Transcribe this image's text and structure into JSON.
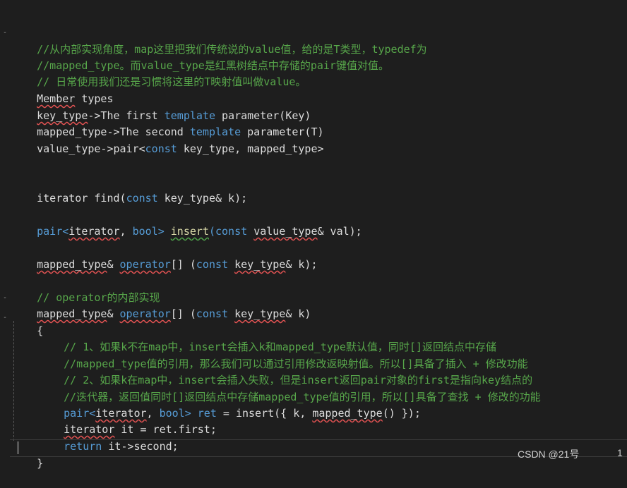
{
  "colors": {
    "background": "#1e1e1e",
    "comment": "#57a64a",
    "keyword": "#569cd6",
    "text": "#dcdcdc",
    "squiggle_error": "#e05252"
  },
  "code": {
    "line1": "//从内部实现角度，map这里把我们传统说的value值，给的是T类型，typedef为",
    "line2": "//mapped_type。而value_type是红黑树结点中存储的pair键值对值。",
    "line3": "// 日常使用我们还是习惯将这里的T映射值叫做value。",
    "line4_a": "Member",
    "line4_b": " types",
    "line5_a": "key_type",
    "line5_b": "->The first ",
    "line5_c": "template",
    "line5_d": " parameter(Key)",
    "line6_a": "mapped_type->The second ",
    "line6_b": "template",
    "line6_c": " parameter(T)",
    "line7_a": "value_type->pair<",
    "line7_b": "const",
    "line7_c": " key_type, mapped_type>",
    "line8_a": "iterator find(",
    "line8_b": "const",
    "line8_c": " key_type& k);",
    "line9_a": "pair<",
    "line9_b": "iterator",
    "line9_c": ", ",
    "line9_d": "bool",
    "line9_e": "> ",
    "line9_f": "insert",
    "line9_g": "(",
    "line9_h": "const",
    "line9_i": " ",
    "line9_j": "value_type",
    "line9_k": "& val);",
    "line10_a": "mapped_type",
    "line10_b": "& ",
    "line10_c": "operator",
    "line10_d": "[] (",
    "line10_e": "const",
    "line10_f": " ",
    "line10_g": "key_type",
    "line10_h": "& k);",
    "line11": "// operator的内部实现",
    "line12_a": "mapped_type",
    "line12_b": "& ",
    "line12_c": "operator",
    "line12_d": "[] (",
    "line12_e": "const",
    "line12_f": " ",
    "line12_g": "key_type",
    "line12_h": "& k)",
    "line13": "{",
    "line14": "// 1、如果k不在map中，insert会插入k和mapped_type默认值，同时[]返回结点中存储",
    "line15": "//mapped_type值的引用，那么我们可以通过引用修改返映射值。所以[]具备了插入 + 修改功能",
    "line16": "// 2、如果k在map中，insert会插入失败，但是insert返回pair对象的first是指向key结点的",
    "line17": "//迭代器，返回值同时[]返回结点中存储mapped_type值的引用，所以[]具备了查找 + 修改的功能",
    "line18_a": "pair<",
    "line18_b": "iterator",
    "line18_c": ", ",
    "line18_d": "bool",
    "line18_e": "> ",
    "line18_f": "ret",
    "line18_g": " = insert({ k, ",
    "line18_h": "mapped_type",
    "line18_i": "() });",
    "line19_a": "iterator",
    "line19_b": " it = ret.first;",
    "line20_a": "return",
    "line20_b": " it->second;",
    "line21": "}"
  },
  "fold_markers": [
    "-",
    "-",
    "-"
  ],
  "watermark": "CSDN @21号",
  "page_number": "1"
}
